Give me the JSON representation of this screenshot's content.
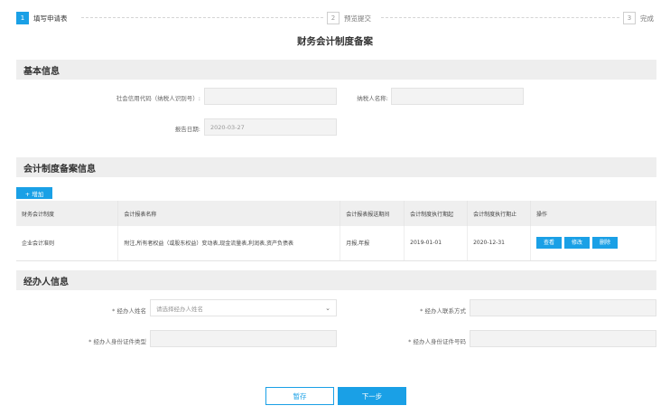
{
  "steps": [
    {
      "num": "1",
      "label": "填写申请表"
    },
    {
      "num": "2",
      "label": "预览提交"
    },
    {
      "num": "3",
      "label": "完成"
    }
  ],
  "page_title": "财务会计制度备案",
  "basic_info": {
    "section_title": "基本信息",
    "credit_code_label": "社会信用代码（纳税人识别号）:",
    "credit_code_value": "",
    "taxpayer_name_label": "纳税人名称:",
    "taxpayer_name_value": "",
    "report_date_label": "报告日期:",
    "report_date_value": "2020-03-27"
  },
  "filing_info": {
    "section_title": "会计制度备案信息",
    "add_button": "+ 增加",
    "columns": [
      "财务会计制度",
      "会计报表名称",
      "会计报表报送期间",
      "会计制度执行期起",
      "会计制度执行期止",
      "操作"
    ],
    "rows": [
      {
        "system": "企业会计准则",
        "reports": "附注,所有者权益（或股东权益）变动表,现金流量表,利润表,资产负债表",
        "period": "月报,年报",
        "start": "2019-01-01",
        "end": "2020-12-31",
        "actions": [
          "查看",
          "修改",
          "删除"
        ]
      }
    ]
  },
  "agent_info": {
    "section_title": "经办人信息",
    "name_label": "* 经办人姓名",
    "name_placeholder": "请选择经办人姓名",
    "contact_label": "* 经办人联系方式",
    "contact_value": "",
    "id_type_label": "* 经办人身份证件类型",
    "id_type_value": "",
    "id_number_label": "* 经办人身份证件号码",
    "id_number_value": ""
  },
  "buttons": {
    "save": "暂存",
    "next": "下一步"
  },
  "colors": {
    "accent": "#1aa0e6",
    "section_bg": "#eeeeee"
  }
}
